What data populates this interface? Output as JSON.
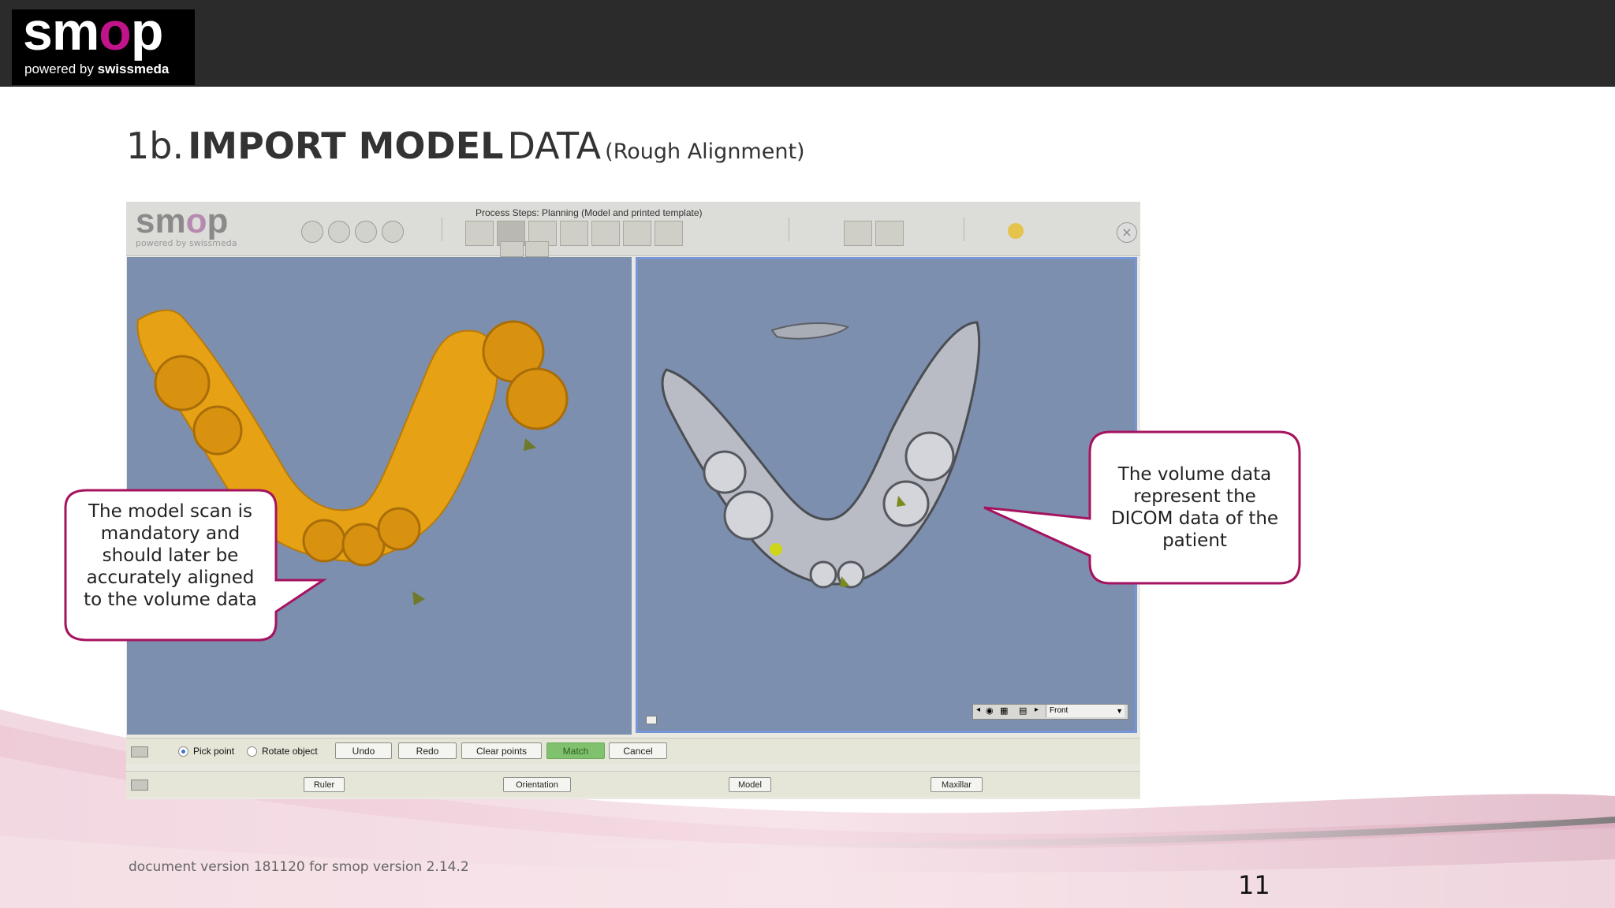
{
  "brand": {
    "logo_text_pre": "sm",
    "logo_text_o": "o",
    "logo_text_post": "p",
    "subtitle_prefix": "powered by ",
    "subtitle_brand": "swissmeda",
    "accent_color": "#c2148a"
  },
  "slide": {
    "title_number": "1b.",
    "title_bold": "IMPORT MODEL",
    "title_regular": "DATA",
    "title_sub": "(Rough Alignment)"
  },
  "app": {
    "logo_pre": "sm",
    "logo_o": "o",
    "logo_post": "p",
    "logo_sub": "powered by swissmeda",
    "process_label": "Process Steps: Planning (Model and printed template)",
    "view_select": "Front",
    "interaction": {
      "radio_pick": "Pick point",
      "radio_pick_selected": true,
      "radio_rotate": "Rotate object",
      "undo": "Undo",
      "redo": "Redo",
      "clear": "Clear points",
      "match": "Match",
      "cancel": "Cancel"
    },
    "tools": {
      "ruler": "Ruler",
      "orientation": "Orientation",
      "model": "Model",
      "maxillar": "Maxillar"
    },
    "colors": {
      "model_scan": "#e6a214",
      "volume": "#b9bcc4",
      "viewport": "#7d8fae",
      "active_border": "#7696d8",
      "match_button": "#7fc16c"
    }
  },
  "callouts": {
    "left": "The model scan is mandatory and should later be accurately aligned to the volume data",
    "right": "The volume data represent the DICOM data of the patient",
    "border_color": "#a5135f"
  },
  "footer": {
    "doc_version": "document version 181120 for smop version 2.14.2",
    "page_number": "11"
  }
}
